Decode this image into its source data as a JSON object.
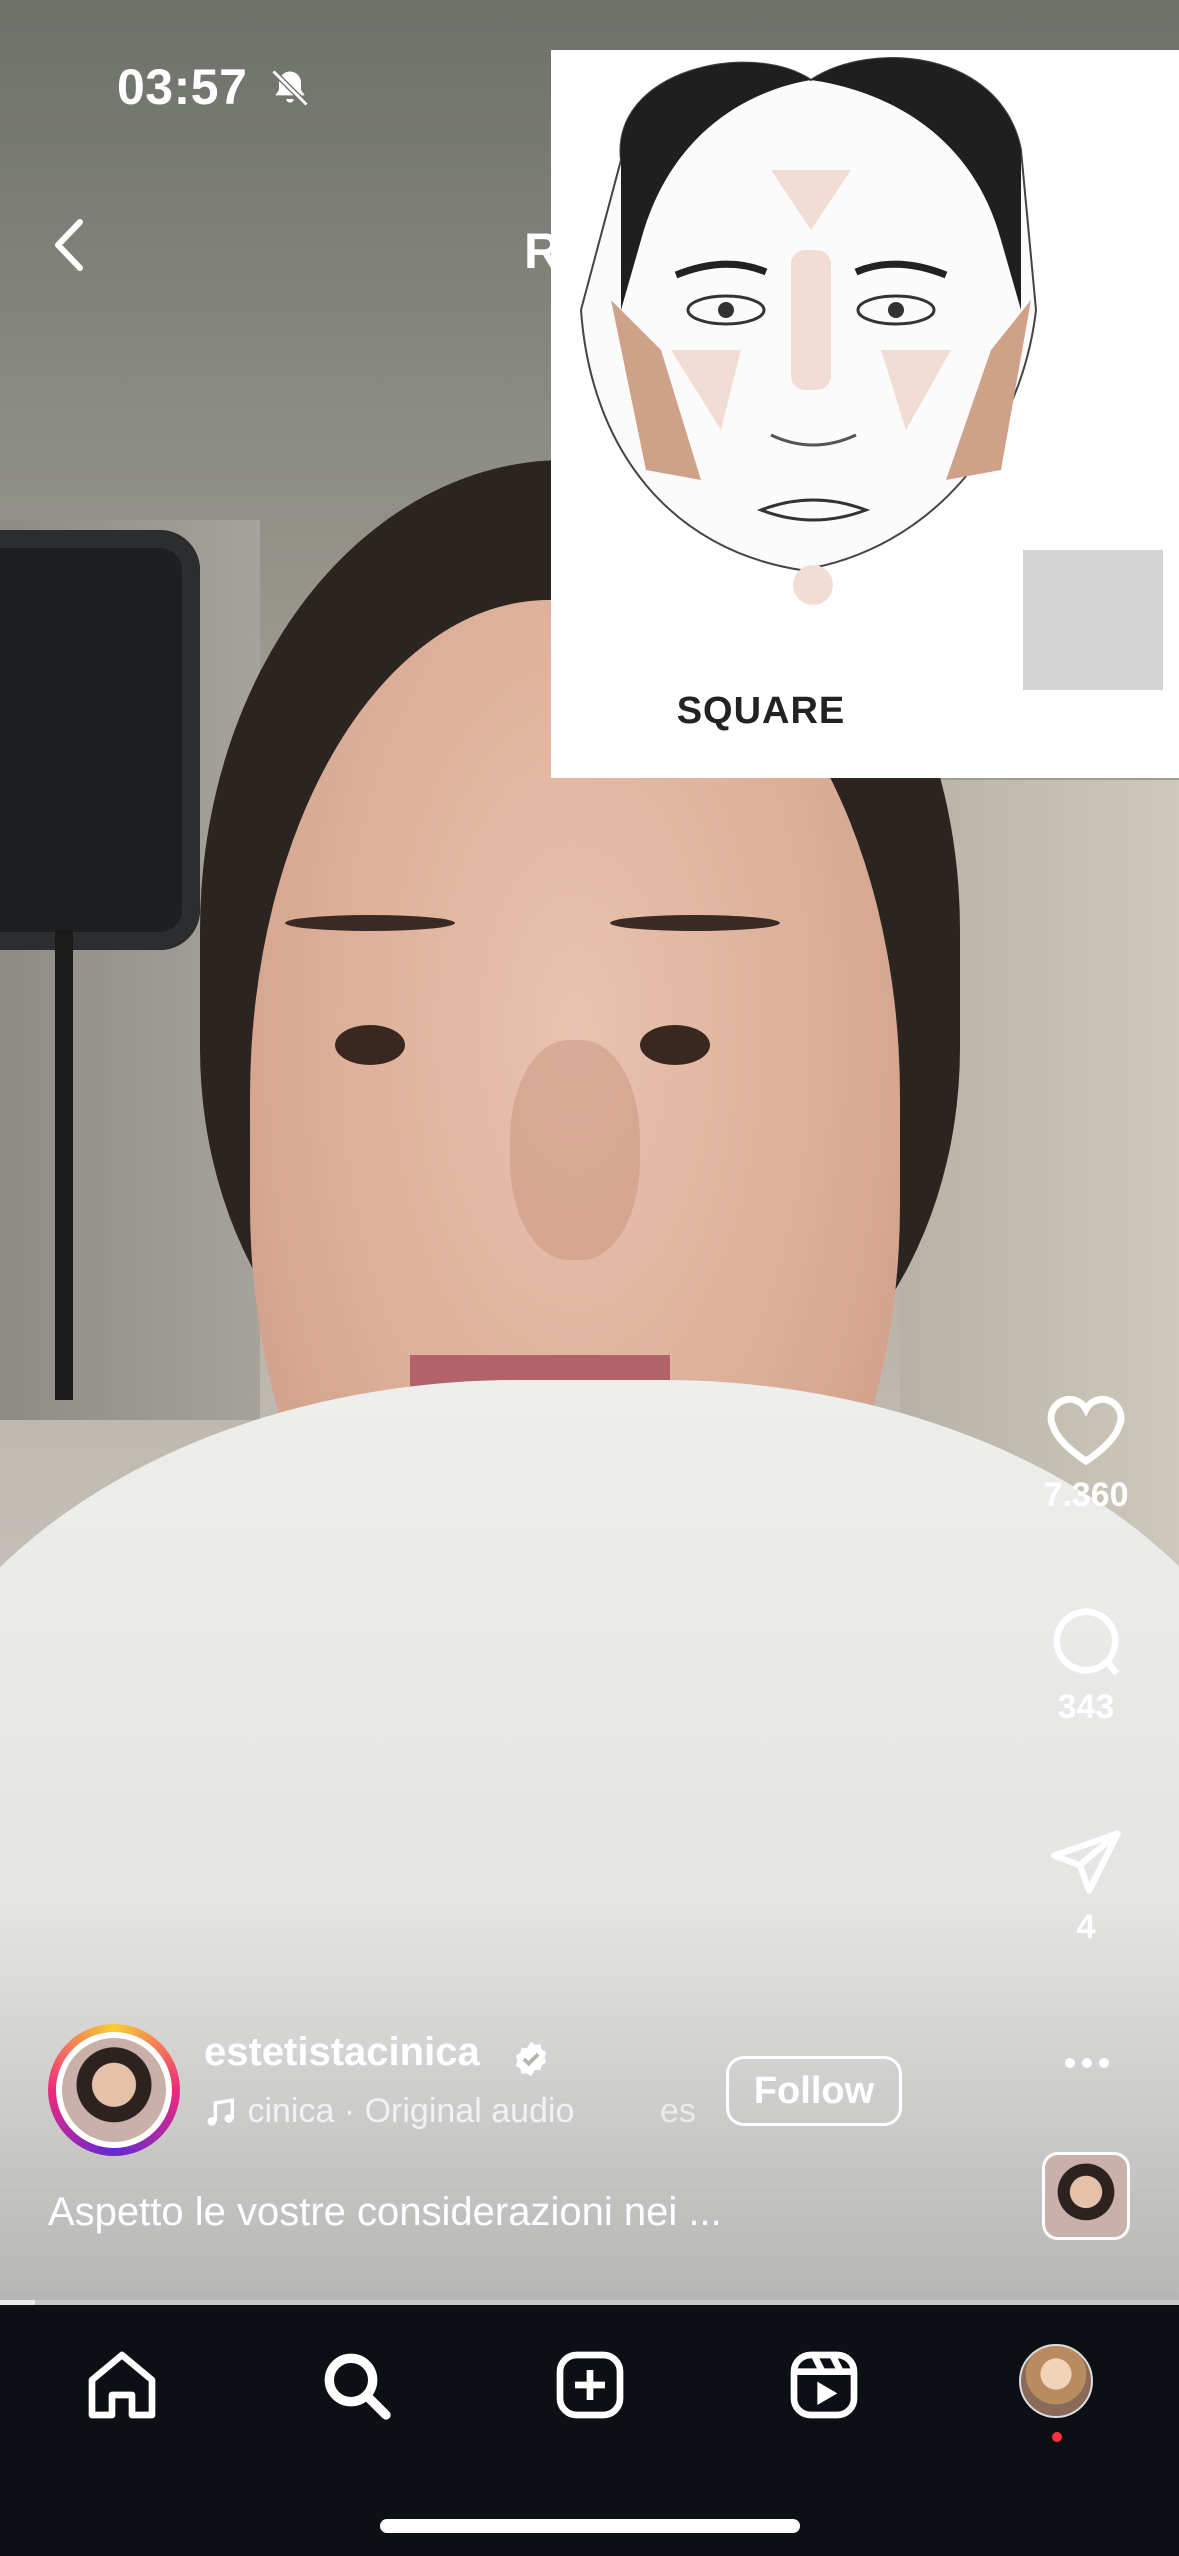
{
  "status_bar": {
    "time": "03:57"
  },
  "header": {
    "title": "Reels"
  },
  "overlay": {
    "label": "SQUARE"
  },
  "actions": {
    "likes": "7.360",
    "comments": "343",
    "shares": "4"
  },
  "author": {
    "username": "estetistacinica",
    "audio_text": "cinica · Original audio",
    "audio_tail": "es",
    "follow_label": "Follow"
  },
  "caption": "Aspetto le vostre considerazioni nei ...",
  "progress": {
    "fraction": 0.03
  },
  "tabs": [
    "home-icon",
    "search-icon",
    "create-icon",
    "reels-icon",
    "profile"
  ]
}
